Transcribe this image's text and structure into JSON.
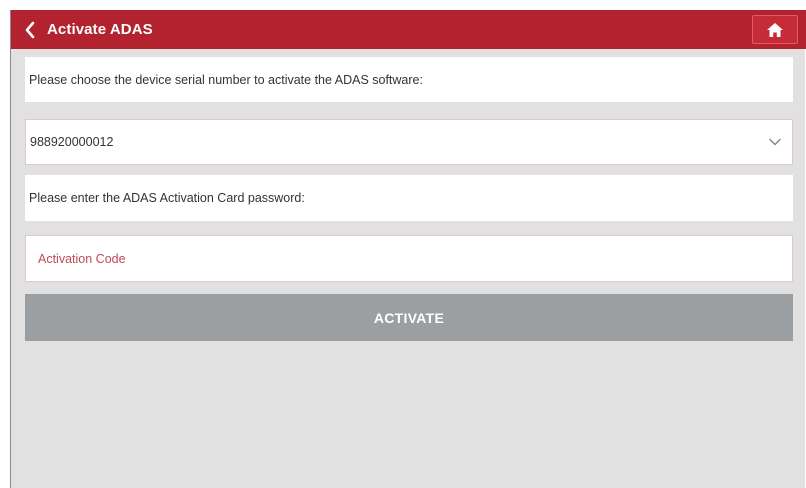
{
  "header": {
    "title": "Activate ADAS",
    "back_icon": "chevron-left-icon",
    "home_icon": "home-icon",
    "background_color": "#b3232f"
  },
  "form": {
    "serial_prompt": "Please choose the device serial number to activate the ADAS software:",
    "serial_selected": "988920000012",
    "password_prompt": "Please enter the ADAS Activation Card password:",
    "code_placeholder": "Activation Code",
    "code_value": ""
  },
  "actions": {
    "activate_label": "ACTIVATE"
  }
}
